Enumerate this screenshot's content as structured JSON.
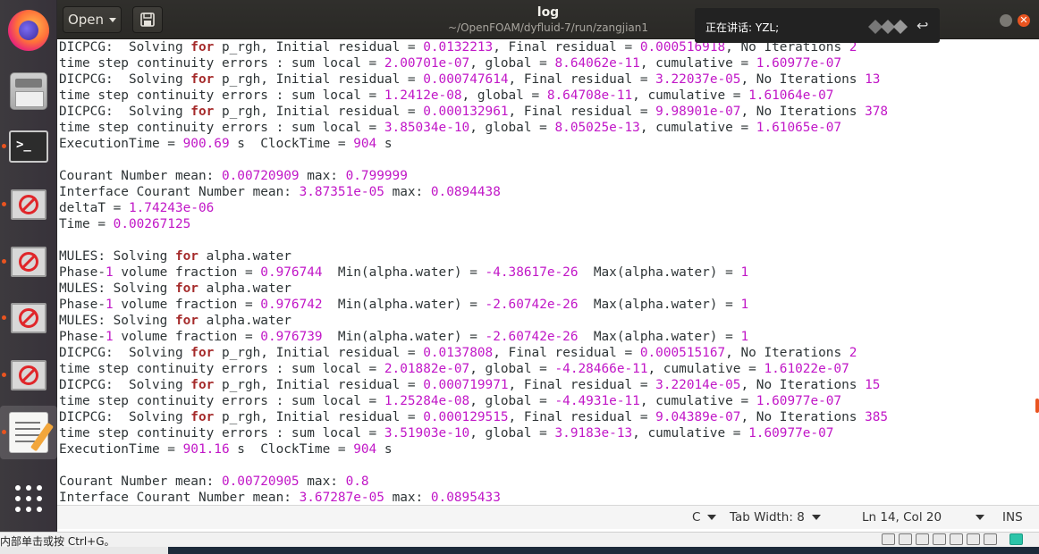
{
  "header": {
    "open_label": "Open",
    "title": "log",
    "subtitle": "~/OpenFOAM/dyfluid-7/run/zangjian1"
  },
  "notification": {
    "text": "正在讲话: YZL;"
  },
  "editor": {
    "lines": [
      [
        [
          "DICPCG:  Solving ",
          "t"
        ],
        [
          "for",
          "k"
        ],
        [
          " p_rgh, Initial residual = ",
          "t"
        ],
        [
          "0.0132213",
          "n"
        ],
        [
          ", Final residual = ",
          "t"
        ],
        [
          "0.000516918",
          "n"
        ],
        [
          ", No Iterations ",
          "t"
        ],
        [
          "2",
          "n"
        ]
      ],
      [
        [
          "time step continuity errors : sum local = ",
          "t"
        ],
        [
          "2.00701e-07",
          "n"
        ],
        [
          ", global = ",
          "t"
        ],
        [
          "8.64062e-11",
          "n"
        ],
        [
          ", cumulative = ",
          "t"
        ],
        [
          "1.60977e-07",
          "n"
        ]
      ],
      [
        [
          "DICPCG:  Solving ",
          "t"
        ],
        [
          "for",
          "k"
        ],
        [
          " p_rgh, Initial residual = ",
          "t"
        ],
        [
          "0.000747614",
          "n"
        ],
        [
          ", Final residual = ",
          "t"
        ],
        [
          "3.22037e-05",
          "n"
        ],
        [
          ", No Iterations ",
          "t"
        ],
        [
          "13",
          "n"
        ]
      ],
      [
        [
          "time step continuity errors : sum local = ",
          "t"
        ],
        [
          "1.2412e-08",
          "n"
        ],
        [
          ", global = ",
          "t"
        ],
        [
          "8.64708e-11",
          "n"
        ],
        [
          ", cumulative = ",
          "t"
        ],
        [
          "1.61064e-07",
          "n"
        ]
      ],
      [
        [
          "DICPCG:  Solving ",
          "t"
        ],
        [
          "for",
          "k"
        ],
        [
          " p_rgh, Initial residual = ",
          "t"
        ],
        [
          "0.000132961",
          "n"
        ],
        [
          ", Final residual = ",
          "t"
        ],
        [
          "9.98901e-07",
          "n"
        ],
        [
          ", No Iterations ",
          "t"
        ],
        [
          "378",
          "n"
        ]
      ],
      [
        [
          "time step continuity errors : sum local = ",
          "t"
        ],
        [
          "3.85034e-10",
          "n"
        ],
        [
          ", global = ",
          "t"
        ],
        [
          "8.05025e-13",
          "n"
        ],
        [
          ", cumulative = ",
          "t"
        ],
        [
          "1.61065e-07",
          "n"
        ]
      ],
      [
        [
          "ExecutionTime = ",
          "t"
        ],
        [
          "900.69",
          "n"
        ],
        [
          " s  ClockTime = ",
          "t"
        ],
        [
          "904",
          "n"
        ],
        [
          " s",
          "t"
        ]
      ],
      [],
      [
        [
          "Courant Number mean: ",
          "t"
        ],
        [
          "0.00720909",
          "n"
        ],
        [
          " max: ",
          "t"
        ],
        [
          "0.799999",
          "n"
        ]
      ],
      [
        [
          "Interface Courant Number mean: ",
          "t"
        ],
        [
          "3.87351e-05",
          "n"
        ],
        [
          " max: ",
          "t"
        ],
        [
          "0.0894438",
          "n"
        ]
      ],
      [
        [
          "deltaT = ",
          "t"
        ],
        [
          "1.74243e-06",
          "n"
        ]
      ],
      [
        [
          "Time = ",
          "t"
        ],
        [
          "0.00267125",
          "n"
        ]
      ],
      [],
      [
        [
          "MULES: Solving ",
          "t"
        ],
        [
          "for",
          "k"
        ],
        [
          " alpha.water",
          "t"
        ]
      ],
      [
        [
          "Phase-",
          "t"
        ],
        [
          "1",
          "n"
        ],
        [
          " volume fraction = ",
          "t"
        ],
        [
          "0.976744",
          "n"
        ],
        [
          "  Min(alpha.water) = ",
          "t"
        ],
        [
          "-4.38617e-26",
          "n"
        ],
        [
          "  Max(alpha.water) = ",
          "t"
        ],
        [
          "1",
          "n"
        ]
      ],
      [
        [
          "MULES: Solving ",
          "t"
        ],
        [
          "for",
          "k"
        ],
        [
          " alpha.water",
          "t"
        ]
      ],
      [
        [
          "Phase-",
          "t"
        ],
        [
          "1",
          "n"
        ],
        [
          " volume fraction = ",
          "t"
        ],
        [
          "0.976742",
          "n"
        ],
        [
          "  Min(alpha.water) = ",
          "t"
        ],
        [
          "-2.60742e-26",
          "n"
        ],
        [
          "  Max(alpha.water) = ",
          "t"
        ],
        [
          "1",
          "n"
        ]
      ],
      [
        [
          "MULES: Solving ",
          "t"
        ],
        [
          "for",
          "k"
        ],
        [
          " alpha.water",
          "t"
        ]
      ],
      [
        [
          "Phase-",
          "t"
        ],
        [
          "1",
          "n"
        ],
        [
          " volume fraction = ",
          "t"
        ],
        [
          "0.976739",
          "n"
        ],
        [
          "  Min(alpha.water) = ",
          "t"
        ],
        [
          "-2.60742e-26",
          "n"
        ],
        [
          "  Max(alpha.water) = ",
          "t"
        ],
        [
          "1",
          "n"
        ]
      ],
      [
        [
          "DICPCG:  Solving ",
          "t"
        ],
        [
          "for",
          "k"
        ],
        [
          " p_rgh, Initial residual = ",
          "t"
        ],
        [
          "0.0137808",
          "n"
        ],
        [
          ", Final residual = ",
          "t"
        ],
        [
          "0.000515167",
          "n"
        ],
        [
          ", No Iterations ",
          "t"
        ],
        [
          "2",
          "n"
        ]
      ],
      [
        [
          "time step continuity errors : sum local = ",
          "t"
        ],
        [
          "2.01882e-07",
          "n"
        ],
        [
          ", global = ",
          "t"
        ],
        [
          "-4.28466e-11",
          "n"
        ],
        [
          ", cumulative = ",
          "t"
        ],
        [
          "1.61022e-07",
          "n"
        ]
      ],
      [
        [
          "DICPCG:  Solving ",
          "t"
        ],
        [
          "for",
          "k"
        ],
        [
          " p_rgh, Initial residual = ",
          "t"
        ],
        [
          "0.000719971",
          "n"
        ],
        [
          ", Final residual = ",
          "t"
        ],
        [
          "3.22014e-05",
          "n"
        ],
        [
          ", No Iterations ",
          "t"
        ],
        [
          "15",
          "n"
        ]
      ],
      [
        [
          "time step continuity errors : sum local = ",
          "t"
        ],
        [
          "1.25284e-08",
          "n"
        ],
        [
          ", global = ",
          "t"
        ],
        [
          "-4.4931e-11",
          "n"
        ],
        [
          ", cumulative = ",
          "t"
        ],
        [
          "1.60977e-07",
          "n"
        ]
      ],
      [
        [
          "DICPCG:  Solving ",
          "t"
        ],
        [
          "for",
          "k"
        ],
        [
          " p_rgh, Initial residual = ",
          "t"
        ],
        [
          "0.000129515",
          "n"
        ],
        [
          ", Final residual = ",
          "t"
        ],
        [
          "9.04389e-07",
          "n"
        ],
        [
          ", No Iterations ",
          "t"
        ],
        [
          "385",
          "n"
        ]
      ],
      [
        [
          "time step continuity errors : sum local = ",
          "t"
        ],
        [
          "3.51903e-10",
          "n"
        ],
        [
          ", global = ",
          "t"
        ],
        [
          "3.9183e-13",
          "n"
        ],
        [
          ", cumulative = ",
          "t"
        ],
        [
          "1.60977e-07",
          "n"
        ]
      ],
      [
        [
          "ExecutionTime = ",
          "t"
        ],
        [
          "901.16",
          "n"
        ],
        [
          " s  ClockTime = ",
          "t"
        ],
        [
          "904",
          "n"
        ],
        [
          " s",
          "t"
        ]
      ],
      [],
      [
        [
          "Courant Number mean: ",
          "t"
        ],
        [
          "0.00720905",
          "n"
        ],
        [
          " max: ",
          "t"
        ],
        [
          "0.8",
          "n"
        ]
      ],
      [
        [
          "Interface Courant Number mean: ",
          "t"
        ],
        [
          "3.67287e-05",
          "n"
        ],
        [
          " max: ",
          "t"
        ],
        [
          "0.0895433",
          "n"
        ]
      ]
    ],
    "colors": {
      "number": "#c117c7",
      "keyword": "#a52a2a",
      "text": "#2e3436"
    }
  },
  "statusbar": {
    "language": "C",
    "tab_width": "Tab Width: 8",
    "position": "Ln 14, Col 20",
    "mode": "INS"
  },
  "vm_bar": {
    "hint": "内部单击或按 Ctrl+G。"
  },
  "accent_color": "#e95420"
}
